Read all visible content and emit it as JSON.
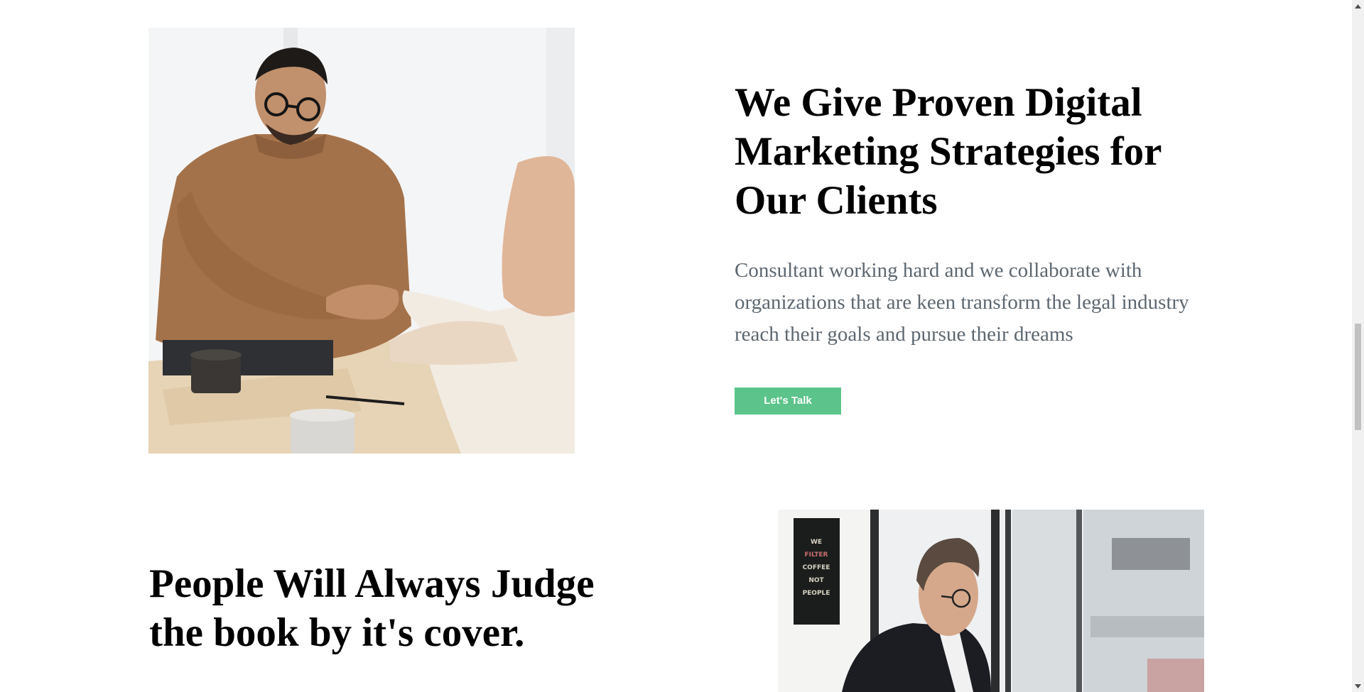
{
  "section_1": {
    "heading": "We Give Proven Digital Marketing Strategies for Our Clients",
    "paragraph": "Consultant working hard and we collaborate with organizations that are keen transform the legal industry reach their goals and pursue their dreams",
    "cta_label": "Let's Talk"
  },
  "section_2": {
    "heading": "People Will Always Judge the book by it's cover."
  },
  "poster_text": [
    "WE",
    "FILTER",
    "COFFEE",
    "NOT",
    "PEOPLE"
  ],
  "colors": {
    "cta_background": "#5cc48a",
    "paragraph_text": "#5d6770",
    "heading_text": "#000000",
    "scrollbar_track": "#f1f1f1",
    "scrollbar_thumb": "#c1c1c1"
  },
  "icons": {
    "scroll_up": "triangle-up-icon",
    "scroll_down": "triangle-down-icon"
  }
}
